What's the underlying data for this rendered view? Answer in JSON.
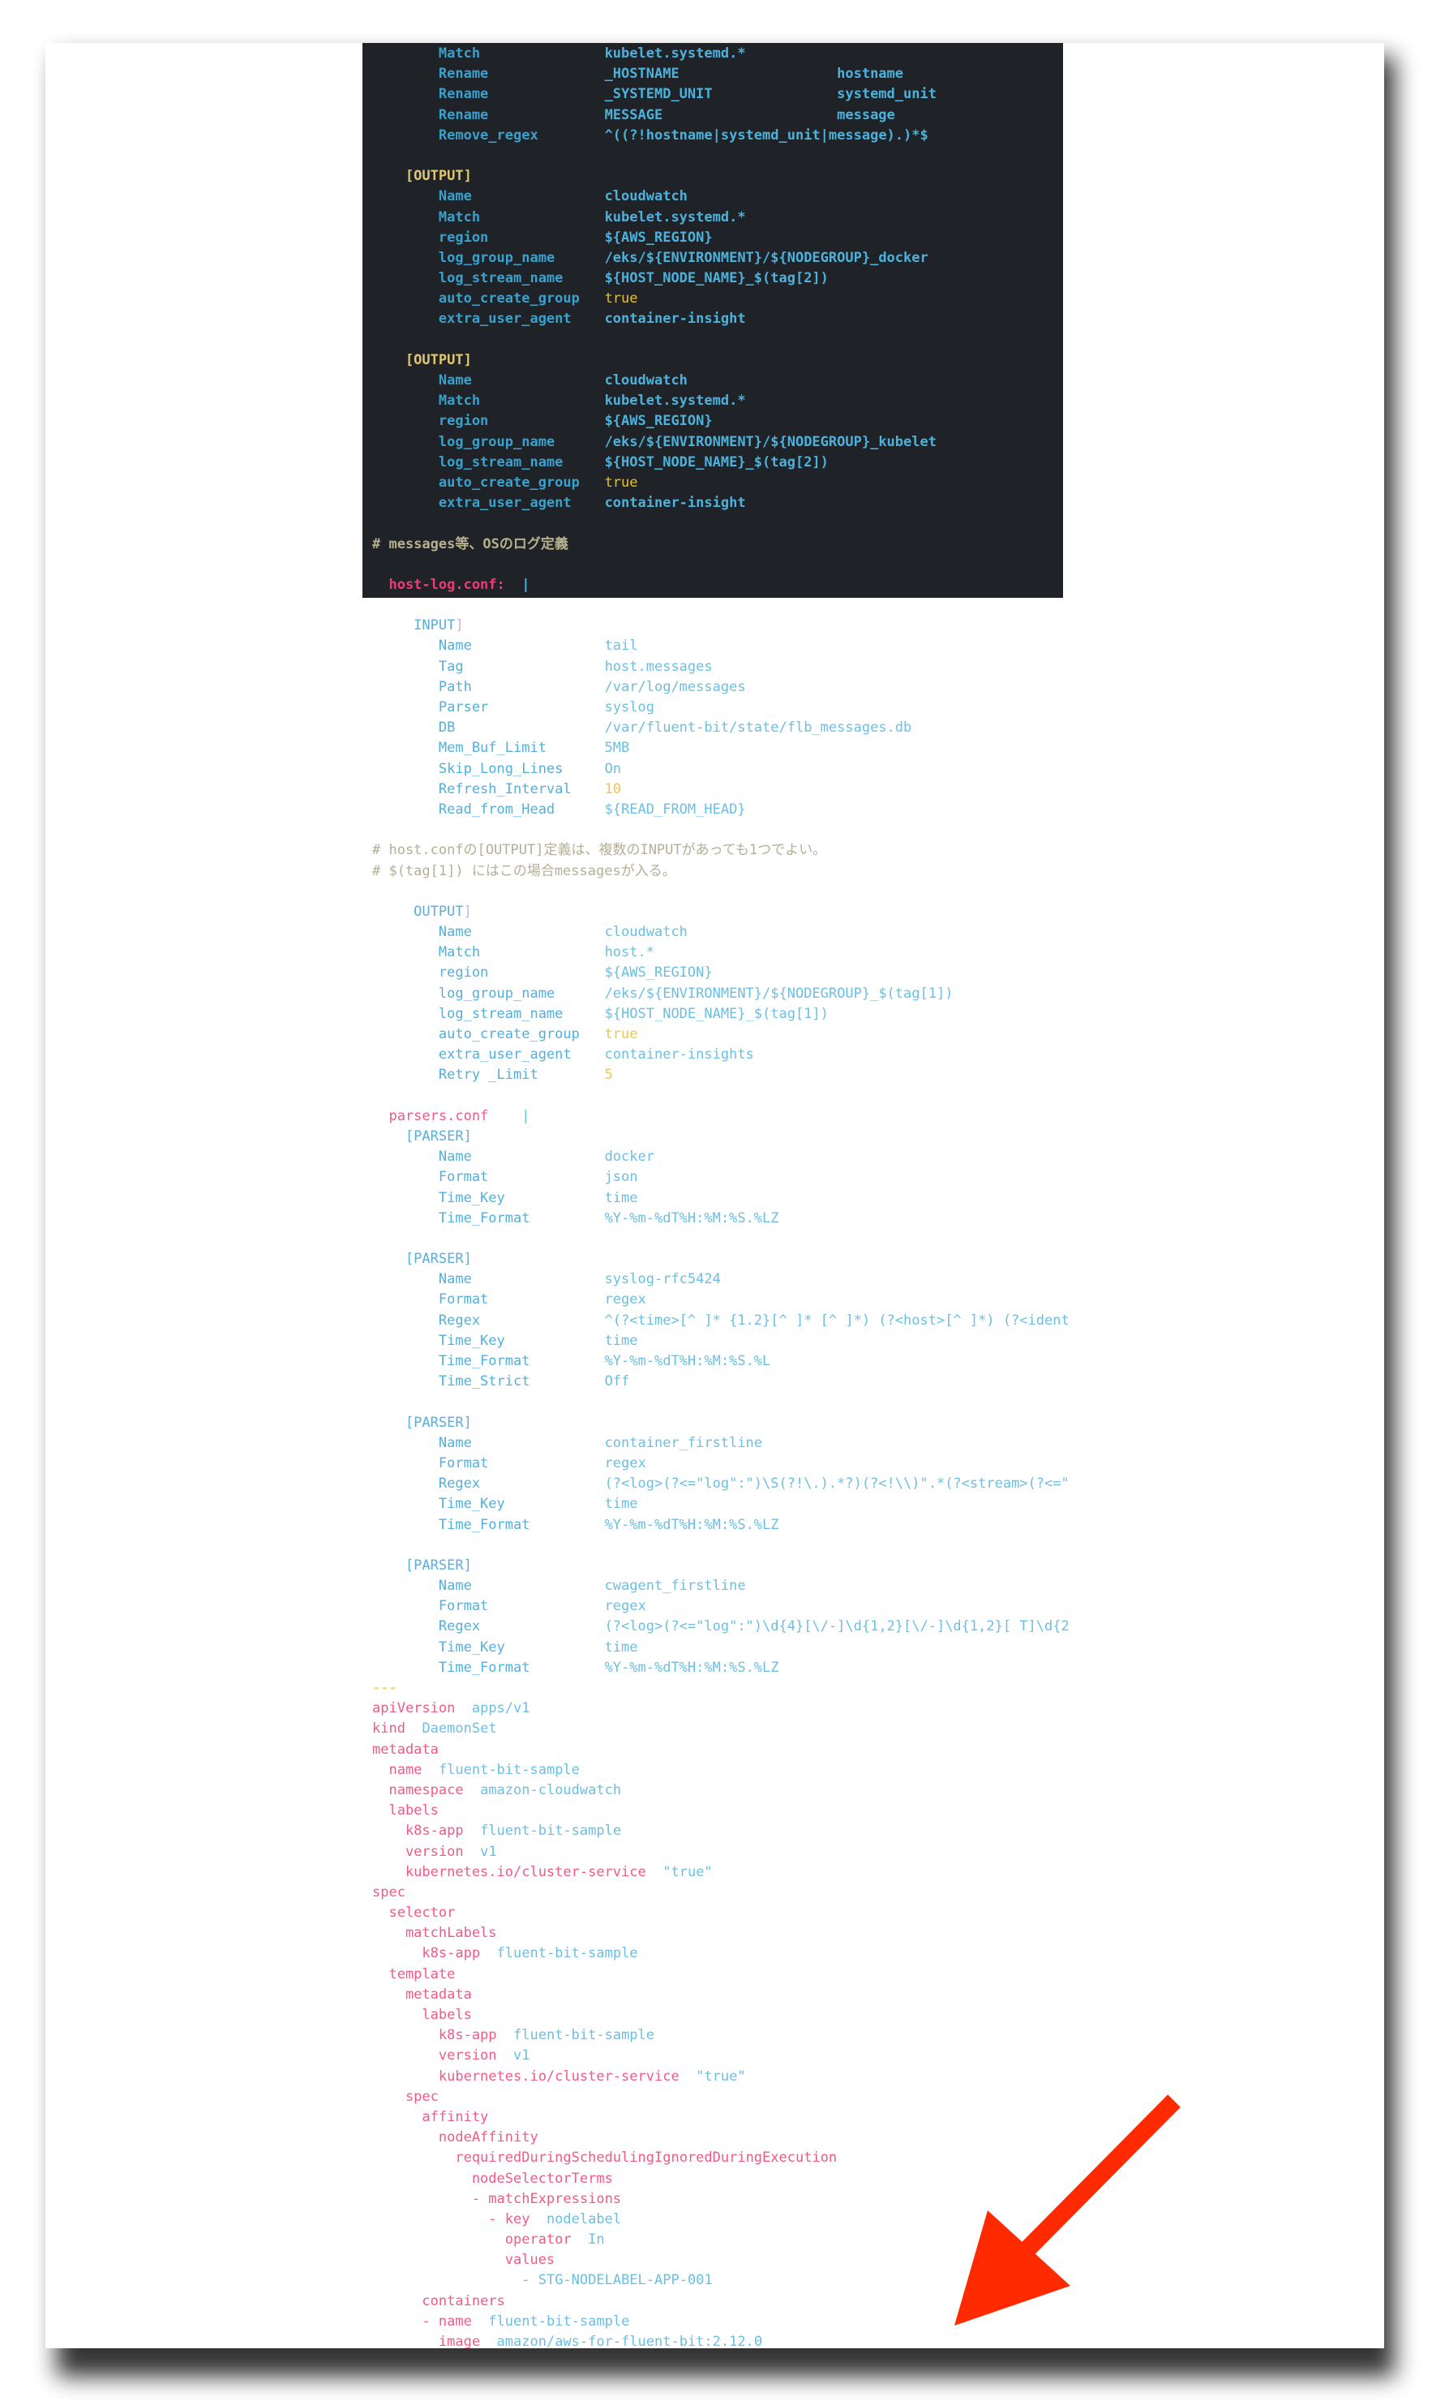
{
  "colors": {
    "arrow": "#ff2a00",
    "code_background": "#1f2327"
  },
  "annotation": {
    "icon": "red-arrow-icon",
    "direction": "down-left"
  },
  "dark_block": {
    "lines": [
      {
        "t": "kv",
        "k": "        Match",
        "v": "kubelet.systemd.*"
      },
      {
        "t": "kv",
        "k": "        Rename",
        "v": "_HOSTNAME",
        "v2": "hostname"
      },
      {
        "t": "kv",
        "k": "        Rename",
        "v": "_SYSTEMD_UNIT",
        "v2": "systemd_unit"
      },
      {
        "t": "kv",
        "k": "        Rename",
        "v": "MESSAGE",
        "v2": "message"
      },
      {
        "t": "kv",
        "k": "        Remove_regex",
        "v": "^((?!hostname|systemd_unit|message).)*$"
      },
      {
        "t": "blank"
      },
      {
        "t": "hdr",
        "k": "    [OUTPUT]"
      },
      {
        "t": "kv",
        "k": "        Name",
        "v": "cloudwatch"
      },
      {
        "t": "kv",
        "k": "        Match",
        "v": "kubelet.systemd.*"
      },
      {
        "t": "kv",
        "k": "        region",
        "v": "${AWS_REGION}"
      },
      {
        "t": "kv",
        "k": "        log_group_name",
        "v": "/eks/${ENVIRONMENT}/${NODEGROUP}_docker"
      },
      {
        "t": "kv",
        "k": "        log_stream_name",
        "v": "${HOST_NODE_NAME}_$(tag[2])"
      },
      {
        "t": "kv",
        "k": "        auto_create_group",
        "v": "true",
        "hl": true
      },
      {
        "t": "kv",
        "k": "        extra_user_agent",
        "v": "container-insight"
      },
      {
        "t": "blank"
      },
      {
        "t": "hdr",
        "k": "    [OUTPUT]"
      },
      {
        "t": "kv",
        "k": "        Name",
        "v": "cloudwatch"
      },
      {
        "t": "kv",
        "k": "        Match",
        "v": "kubelet.systemd.*"
      },
      {
        "t": "kv",
        "k": "        region",
        "v": "${AWS_REGION}"
      },
      {
        "t": "kv",
        "k": "        log_group_name",
        "v": "/eks/${ENVIRONMENT}/${NODEGROUP}_kubelet"
      },
      {
        "t": "kv",
        "k": "        log_stream_name",
        "v": "${HOST_NODE_NAME}_$(tag[2])"
      },
      {
        "t": "kv",
        "k": "        auto_create_group",
        "v": "true",
        "hl": true
      },
      {
        "t": "kv",
        "k": "        extra_user_agent",
        "v": "container-insight"
      },
      {
        "t": "blank"
      },
      {
        "t": "cmt",
        "k": "# messages等、OSのログ定義"
      },
      {
        "t": "blank"
      },
      {
        "t": "y",
        "k": "  host-log.conf:",
        "v": "|"
      }
    ]
  },
  "light_block": {
    "lines": [
      {
        "t": "blank"
      },
      {
        "t": "hdr",
        "k": "     INPUT",
        "br": "]"
      },
      {
        "t": "kv",
        "k": "        Name",
        "v": "tail"
      },
      {
        "t": "kv",
        "k": "        Tag",
        "v": "host.messages"
      },
      {
        "t": "kv",
        "k": "        Path",
        "v": "/var/log/messages"
      },
      {
        "t": "kv",
        "k": "        Parser",
        "v": "syslog"
      },
      {
        "t": "kv",
        "k": "        DB",
        "v": "/var/fluent-bit/state/flb_messages.db"
      },
      {
        "t": "kv",
        "k": "        Mem_Buf_Limit",
        "v": "5MB"
      },
      {
        "t": "kv",
        "k": "        Skip_Long_Lines",
        "v": "On"
      },
      {
        "t": "kv",
        "k": "        Refresh_Interval",
        "v": "10",
        "hl": true
      },
      {
        "t": "kv",
        "k": "        Read_from_Head",
        "v": "${READ_FROM_HEAD}"
      },
      {
        "t": "blank"
      },
      {
        "t": "cmt",
        "k": "# host.confの[OUTPUT]定義は、複数のINPUTがあっても1つでよい。"
      },
      {
        "t": "cmt",
        "k": "# $(tag[1]) にはこの場合messagesが入る。"
      },
      {
        "t": "blank"
      },
      {
        "t": "hdr",
        "k": "     OUTPUT",
        "br": "]"
      },
      {
        "t": "kv",
        "k": "        Name",
        "v": "cloudwatch"
      },
      {
        "t": "kv",
        "k": "        Match",
        "v": "host.*"
      },
      {
        "t": "kv",
        "k": "        region",
        "v": "${AWS_REGION}"
      },
      {
        "t": "kv",
        "k": "        log_group_name",
        "v": "/eks/${ENVIRONMENT}/${NODEGROUP}_$(tag[1])"
      },
      {
        "t": "kv",
        "k": "        log_stream_name",
        "v": "${HOST_NODE_NAME}_$(tag[1])"
      },
      {
        "t": "kv",
        "k": "        auto_create_group",
        "v": "true",
        "hl": true
      },
      {
        "t": "kv",
        "k": "        extra_user_agent",
        "v": "container-insights"
      },
      {
        "t": "kv",
        "k": "        Retry _Limit",
        "v": "5",
        "hl": true
      },
      {
        "t": "blank"
      },
      {
        "t": "y",
        "k": "  parsers.conf",
        "v": "  |"
      },
      {
        "t": "hdr",
        "k": "    [PARSER]"
      },
      {
        "t": "kv",
        "k": "        Name",
        "v": "docker"
      },
      {
        "t": "kv",
        "k": "        Format",
        "v": "json"
      },
      {
        "t": "kv",
        "k": "        Time_Key",
        "v": "time"
      },
      {
        "t": "kv",
        "k": "        Time_Format",
        "v": "%Y-%m-%dT%H:%M:%S.%LZ"
      },
      {
        "t": "blank"
      },
      {
        "t": "hdr",
        "k": "    [PARSER]"
      },
      {
        "t": "kv",
        "k": "        Name",
        "v": "syslog-rfc5424"
      },
      {
        "t": "kv",
        "k": "        Format",
        "v": "regex"
      },
      {
        "t": "kv",
        "k": "        Regex",
        "v": "^(?<time>[^ ]* {1.2}[^ ]* [^ ]*) (?<host>[^ ]*) (?<ident"
      },
      {
        "t": "kv",
        "k": "        Time_Key",
        "v": "time"
      },
      {
        "t": "kv",
        "k": "        Time_Format",
        "v": "%Y-%m-%dT%H:%M:%S.%L"
      },
      {
        "t": "kv",
        "k": "        Time_Strict",
        "v": "Off"
      },
      {
        "t": "blank"
      },
      {
        "t": "hdr",
        "k": "    [PARSER]"
      },
      {
        "t": "kv",
        "k": "        Name",
        "v": "container_firstline"
      },
      {
        "t": "kv",
        "k": "        Format",
        "v": "regex"
      },
      {
        "t": "kv",
        "k": "        Regex",
        "v": "(?<log>(?<=\"log\":\")\\S(?!\\.).*?)(?<!\\\\)\".*(?<stream>(?<=\""
      },
      {
        "t": "kv",
        "k": "        Time_Key",
        "v": "time"
      },
      {
        "t": "kv",
        "k": "        Time_Format",
        "v": "%Y-%m-%dT%H:%M:%S.%LZ"
      },
      {
        "t": "blank"
      },
      {
        "t": "hdr",
        "k": "    [PARSER]"
      },
      {
        "t": "kv",
        "k": "        Name",
        "v": "cwagent_firstline"
      },
      {
        "t": "kv",
        "k": "        Format",
        "v": "regex"
      },
      {
        "t": "kv",
        "k": "        Regex",
        "v": "(?<log>(?<=\"log\":\")\\d{4}[\\/-]\\d{1,2}[\\/-]\\d{1,2}[ T]\\d{2"
      },
      {
        "t": "kv",
        "k": "        Time_Key",
        "v": "time"
      },
      {
        "t": "kv",
        "k": "        Time_Format",
        "v": "%Y-%m-%dT%H:%M:%S.%LZ"
      },
      {
        "t": "sep",
        "k": "---"
      },
      {
        "t": "y",
        "k": "apiVersion",
        "v": "apps/v1"
      },
      {
        "t": "y",
        "k": "kind",
        "v": "DaemonSet"
      },
      {
        "t": "y",
        "k": "metadata"
      },
      {
        "t": "y",
        "k": "  name",
        "v": "fluent-bit-sample"
      },
      {
        "t": "y",
        "k": "  namespace",
        "v": "amazon-cloudwatch"
      },
      {
        "t": "y",
        "k": "  labels"
      },
      {
        "t": "y",
        "k": "    k8s-app",
        "v": "fluent-bit-sample"
      },
      {
        "t": "y",
        "k": "    version",
        "v": "v1"
      },
      {
        "t": "y",
        "k": "    kubernetes.io/cluster-service",
        "v": "\"true\""
      },
      {
        "t": "y",
        "k": "spec"
      },
      {
        "t": "y",
        "k": "  selector"
      },
      {
        "t": "y",
        "k": "    matchLabels"
      },
      {
        "t": "y",
        "k": "      k8s-app",
        "v": "fluent-bit-sample"
      },
      {
        "t": "y",
        "k": "  template"
      },
      {
        "t": "y",
        "k": "    metadata"
      },
      {
        "t": "y",
        "k": "      labels"
      },
      {
        "t": "y",
        "k": "        k8s-app",
        "v": "fluent-bit-sample"
      },
      {
        "t": "y",
        "k": "        version",
        "v": "v1"
      },
      {
        "t": "y",
        "k": "        kubernetes.io/cluster-service",
        "v": "\"true\""
      },
      {
        "t": "y",
        "k": "    spec"
      },
      {
        "t": "y",
        "k": "      affinity"
      },
      {
        "t": "y",
        "k": "        nodeAffinity"
      },
      {
        "t": "y",
        "k": "          requiredDuringSchedulingIgnoredDuringExecution"
      },
      {
        "t": "y",
        "k": "            nodeSelectorTerms"
      },
      {
        "t": "y",
        "k": "            - matchExpressions"
      },
      {
        "t": "y",
        "k": "              - key",
        "v": "nodelabel"
      },
      {
        "t": "y",
        "k": "                operator",
        "v": "In"
      },
      {
        "t": "y",
        "k": "                values"
      },
      {
        "t": "y",
        "k": "                ",
        "v": "- STG-NODELABEL-APP-001"
      },
      {
        "t": "y",
        "k": "      containers"
      },
      {
        "t": "y",
        "k": "      - name",
        "v": "fluent-bit-sample"
      },
      {
        "t": "y",
        "k": "        image",
        "v": "amazon/aws-for-fluent-bit:2.12.0"
      }
    ]
  }
}
